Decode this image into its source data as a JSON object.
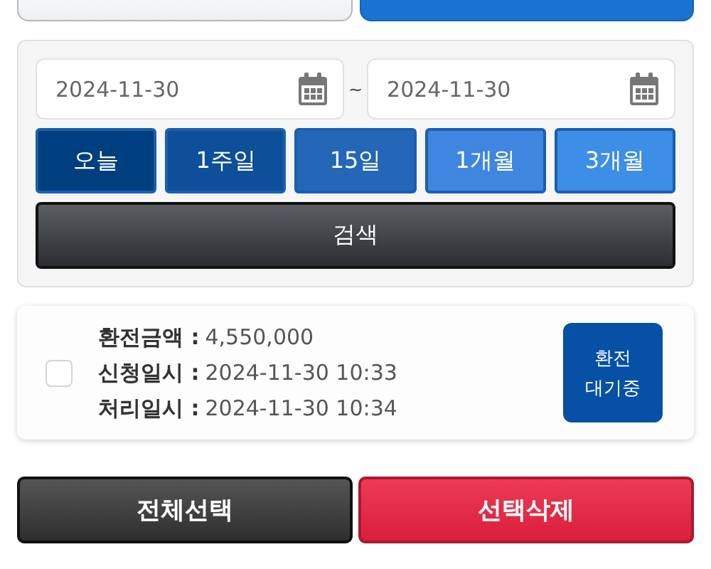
{
  "tabs": [
    {
      "selected": false
    },
    {
      "selected": true
    }
  ],
  "search": {
    "date_from": "2024-11-30",
    "separator": "~",
    "date_to": "2024-11-30",
    "periods": [
      {
        "label": "오늘",
        "color": "#003f7f"
      },
      {
        "label": "1주일",
        "color": "#0d4f98"
      },
      {
        "label": "15일",
        "color": "#2466b8"
      },
      {
        "label": "1개월",
        "color": "#3f86e0"
      },
      {
        "label": "3개월",
        "color": "#3c8ee6"
      }
    ],
    "button": "검색"
  },
  "records": [
    {
      "checked": false,
      "fields": [
        {
          "label": "환전금액 :",
          "value": "4,550,000"
        },
        {
          "label": "신청일시 :",
          "value": "2024-11-30 10:33"
        },
        {
          "label": "처리일시 :",
          "value": "2024-11-30 10:34"
        }
      ],
      "status": [
        "환전",
        "대기중"
      ]
    }
  ],
  "actions": [
    {
      "kind": "neutral",
      "label": "전체선택"
    },
    {
      "kind": "danger",
      "label": "선택삭제"
    }
  ]
}
